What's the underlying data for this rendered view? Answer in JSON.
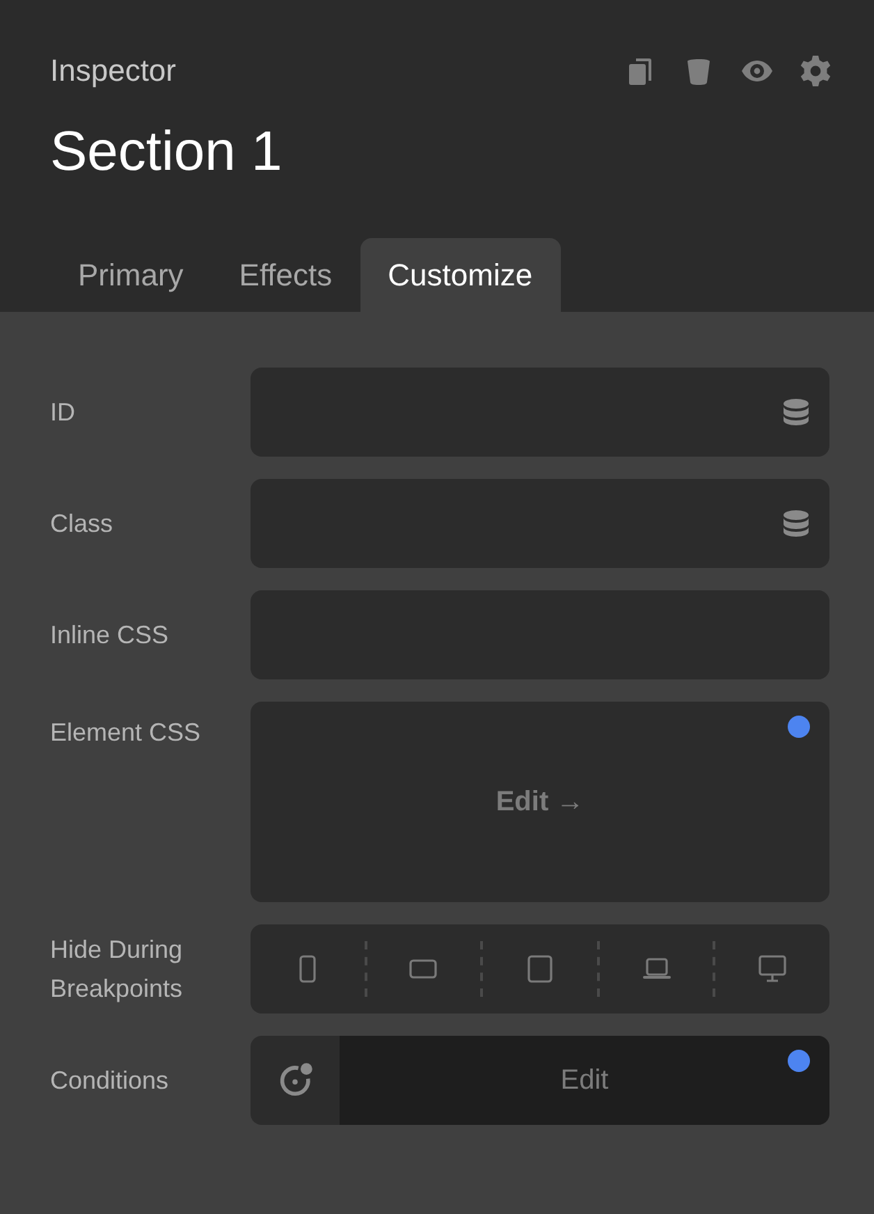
{
  "header": {
    "label": "Inspector",
    "title": "Section 1"
  },
  "tabs": [
    {
      "label": "Primary",
      "selected": false
    },
    {
      "label": "Effects",
      "selected": false
    },
    {
      "label": "Customize",
      "selected": true
    }
  ],
  "rows": [
    {
      "kind": "text",
      "label": "ID",
      "dynamic": true
    },
    {
      "kind": "text",
      "label": "Class",
      "dynamic": true
    },
    {
      "kind": "text",
      "label": "Inline CSS",
      "dynamic": false
    },
    {
      "kind": "editor",
      "label": "Element CSS",
      "action": "Edit →",
      "modified": true
    },
    {
      "kind": "breakpoints",
      "label": "Hide During Breakpoints",
      "devices": [
        {
          "kind": "phone",
          "selected": false
        },
        {
          "kind": "landscape",
          "selected": false
        },
        {
          "kind": "tablet",
          "selected": false
        },
        {
          "kind": "laptop",
          "selected": false
        },
        {
          "kind": "desktop",
          "selected": false
        }
      ]
    },
    {
      "kind": "conditions",
      "label": "Conditions",
      "action": "Edit",
      "modified": true
    }
  ]
}
